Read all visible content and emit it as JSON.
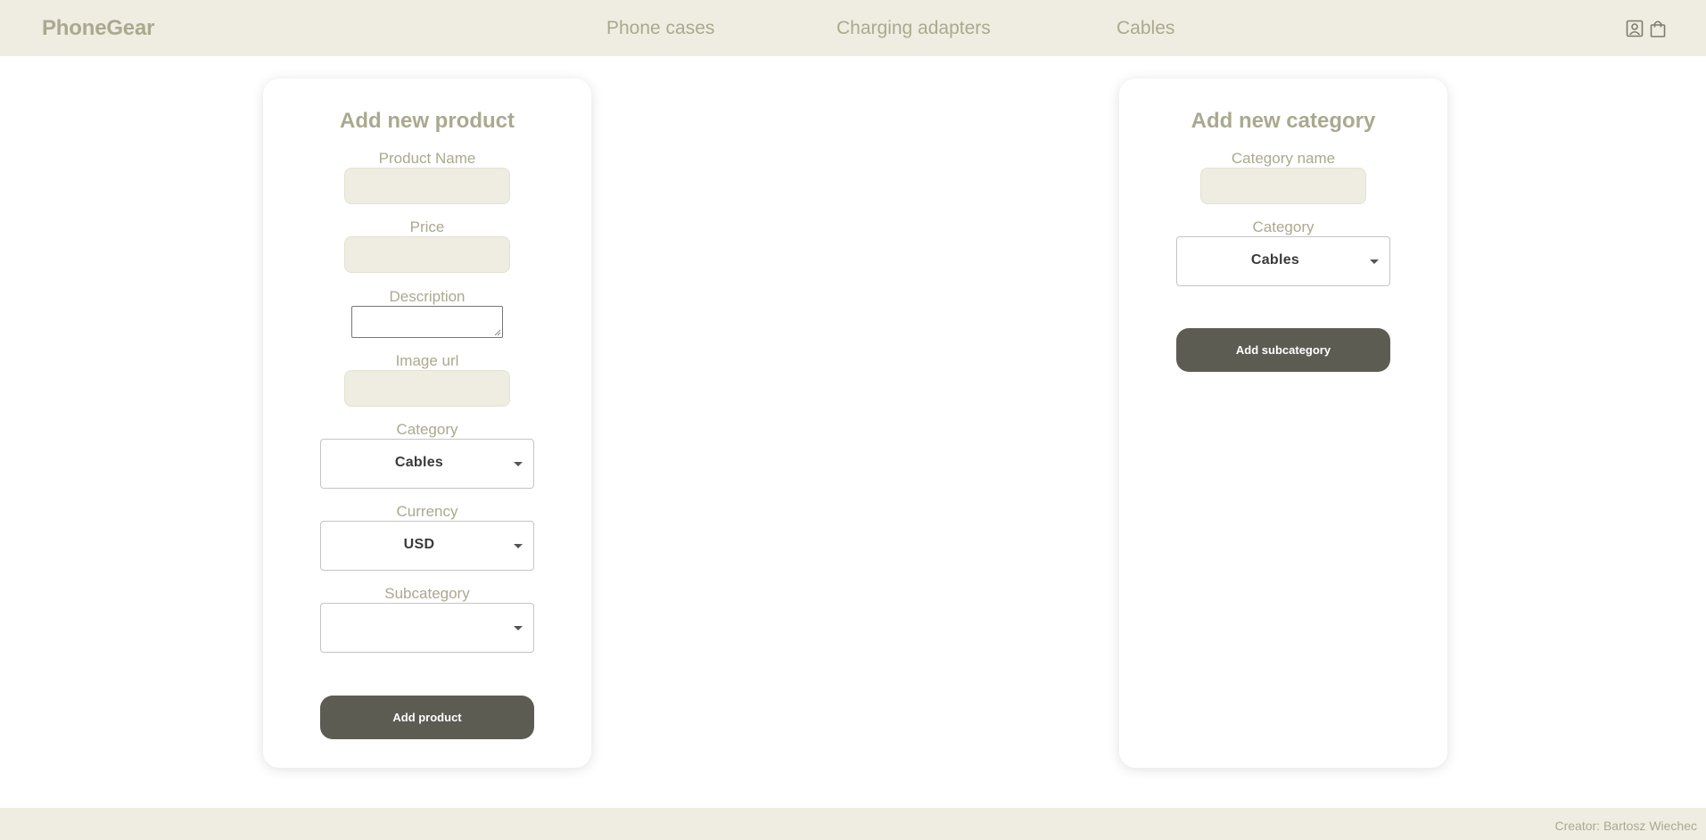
{
  "header": {
    "logo": "PhoneGear",
    "nav": [
      {
        "label": "Phone cases"
      },
      {
        "label": "Charging adapters"
      },
      {
        "label": "Cables"
      }
    ],
    "icons": [
      "user-icon",
      "shopping-bag-icon"
    ]
  },
  "product_form": {
    "title": "Add new product",
    "product_name_label": "Product Name",
    "product_name_value": "",
    "price_label": "Price",
    "price_value": "",
    "description_label": "Description",
    "description_value": "",
    "image_url_label": "Image url",
    "image_url_value": "",
    "category_label": "Category",
    "category_value": "Cables",
    "currency_label": "Currency",
    "currency_value": "USD",
    "subcategory_label": "Subcategory",
    "subcategory_value": "",
    "submit_label": "Add product"
  },
  "category_form": {
    "title": "Add new category",
    "category_name_label": "Category name",
    "category_name_value": "",
    "category_label": "Category",
    "category_value": "Cables",
    "submit_label": "Add subcategory"
  },
  "footer": {
    "text": "Creator: Bartosz Wiechec"
  },
  "colors": {
    "header_bg": "#efede2",
    "accent_text": "#aaa98f",
    "button_bg": "#5c5c53",
    "input_bg": "#efede2"
  }
}
